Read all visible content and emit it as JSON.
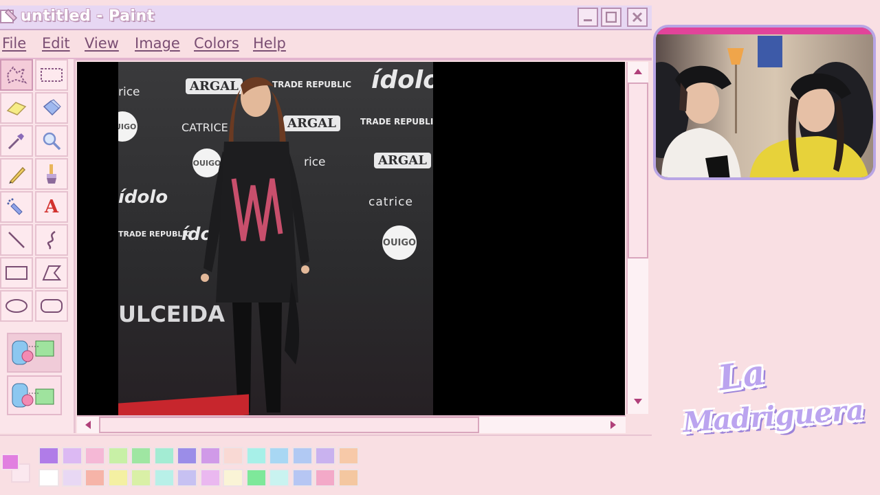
{
  "window": {
    "title": "untitled - Paint",
    "controls": {
      "minimize": "minimize",
      "maximize": "maximize",
      "close": "close"
    }
  },
  "menu": {
    "items": [
      {
        "label": "File"
      },
      {
        "label": "Edit"
      },
      {
        "label": "View"
      },
      {
        "label": "Image"
      },
      {
        "label": "Colors"
      },
      {
        "label": "Help"
      }
    ]
  },
  "tools": [
    {
      "name": "free-form-select-icon"
    },
    {
      "name": "rect-select-icon"
    },
    {
      "name": "eraser-icon"
    },
    {
      "name": "fill-bucket-icon"
    },
    {
      "name": "color-picker-icon"
    },
    {
      "name": "magnifier-icon"
    },
    {
      "name": "pencil-icon"
    },
    {
      "name": "brush-icon"
    },
    {
      "name": "airbrush-icon"
    },
    {
      "name": "text-icon",
      "glyph": "A"
    },
    {
      "name": "line-icon"
    },
    {
      "name": "curve-icon"
    },
    {
      "name": "rectangle-icon"
    },
    {
      "name": "polygon-icon"
    },
    {
      "name": "ellipse-icon"
    },
    {
      "name": "rounded-rect-icon"
    }
  ],
  "canvas": {
    "backdrop": {
      "brand_idolo": "ídolo",
      "brand_argal": "ARGAL",
      "brand_catrice": "CATRICE",
      "brand_catrice_lower": "catrice",
      "brand_trade_republic": "TRADE REPUBLIC",
      "brand_ouigo": "OUIGO",
      "brand_ulceida": "ULCEIDA",
      "brand_rice": "rice"
    }
  },
  "palette": {
    "foreground": "#e17fe0",
    "background": "#fbe8ef",
    "row1": [
      "#b07ce8",
      "#dcb9f3",
      "#f5b8d6",
      "#c8f0a6",
      "#9fe6a2",
      "#a3ecd3",
      "#9b8de8",
      "#d09ae8",
      "#f9d9d4",
      "#a7f0e8",
      "#a8d7f3",
      "#b1c9f3",
      "#c9b2ef",
      "#f7c9a8"
    ],
    "row2": [
      "#ffffff",
      "#e8d8f4",
      "#f6b4a8",
      "#f4f0a2",
      "#d9f0a6",
      "#b8f0e8",
      "#c7c1f2",
      "#eab8f0",
      "#faf4d6",
      "#7ee89a",
      "#c9f3f0",
      "#b6c6f3",
      "#f3a9c8",
      "#f4c7a0"
    ]
  },
  "logo": {
    "line1": "La",
    "line2": "Madriguera"
  }
}
